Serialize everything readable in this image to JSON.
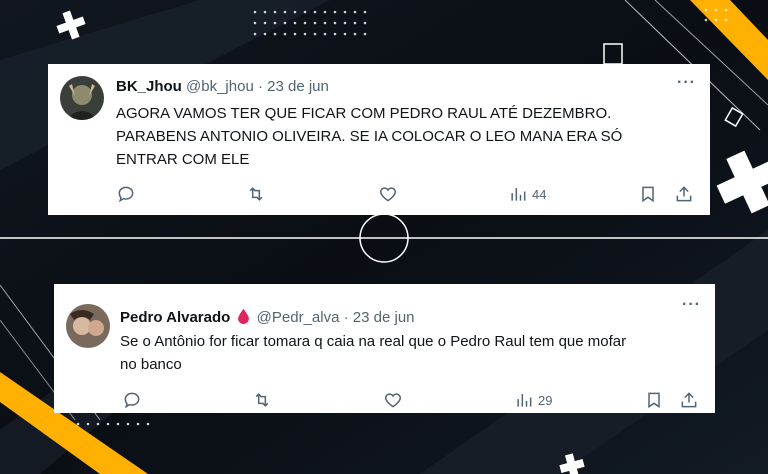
{
  "colors": {
    "accent_yellow": "#ffb000",
    "background": "#0d1117",
    "name_text": "#0f1419",
    "meta_text": "#536471",
    "drop_red": "#e0245e"
  },
  "tweets": [
    {
      "display_name": "BK_Jhou",
      "handle": "@bk_jhou",
      "separator": "·",
      "date": "23 de jun",
      "text_lines": [
        "AGORA VAMOS TER QUE FICAR COM PEDRO RAUL ATÉ DEZEMBRO.",
        "PARABENS ANTONIO OLIVEIRA. SE IA COLOCAR O LEO MANA ERA SÓ",
        "ENTRAR COM ELE"
      ],
      "more_label": "···",
      "views": "44",
      "icons": [
        "reply-icon",
        "retweet-icon",
        "like-icon",
        "views-icon",
        "bookmark-icon",
        "share-icon"
      ]
    },
    {
      "display_name": "Pedro Alvarado",
      "handle": "@Pedr_alva",
      "separator": "·",
      "date": "23 de jun",
      "text_lines": [
        "Se o Antônio for ficar tomara q caia na real que o Pedro Raul tem que mofar",
        "no banco"
      ],
      "more_label": "···",
      "views": "29",
      "icons": [
        "reply-icon",
        "retweet-icon",
        "like-icon",
        "views-icon",
        "bookmark-icon",
        "share-icon"
      ]
    }
  ]
}
